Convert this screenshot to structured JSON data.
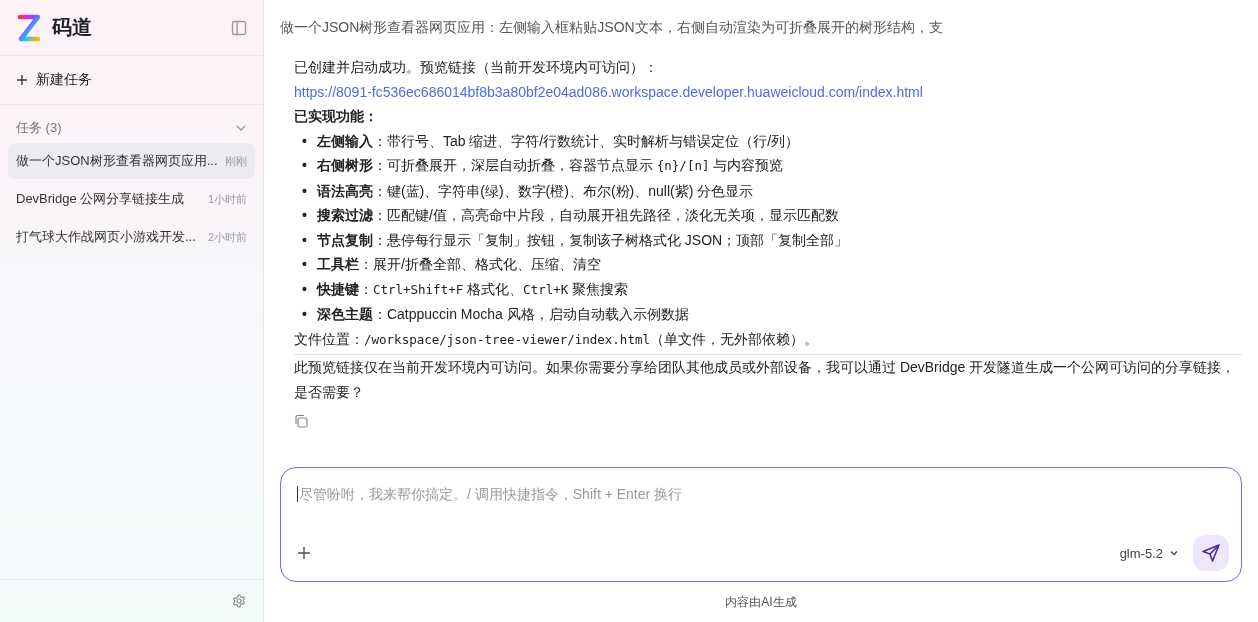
{
  "app": {
    "name": "码道"
  },
  "sidebar": {
    "new_task": "新建任务",
    "section": {
      "label": "任务 (3)",
      "expanded": true
    },
    "tasks": [
      {
        "title": "做一个JSON树形查看器网页应用...",
        "time": "刚刚",
        "selected": true
      },
      {
        "title": "DevBridge 公网分享链接生成",
        "time": "1小时前",
        "selected": false
      },
      {
        "title": "打气球大作战网页小游戏开发...",
        "time": "2小时前",
        "selected": false
      }
    ]
  },
  "conversation": {
    "title": "做一个JSON树形查看器网页应用：左侧输入框粘贴JSON文本，右侧自动渲染为可折叠展开的树形结构，支",
    "message": {
      "intro": "已创建并启动成功。预览链接（当前开发环境内可访问）：",
      "link": "https://8091-fc536ec686014bf8b3a80bf2e04ad086.workspace.developer.huaweicloud.com/index.html",
      "features_heading": "已实现功能：",
      "features": [
        {
          "marker": "•",
          "label": "左侧输入",
          "parts": [
            {
              "kind": "text",
              "text": "：带行号、Tab 缩进、字符/行数统计、实时解析与错误定位（行/列）"
            }
          ]
        },
        {
          "marker": "•",
          "label": "右侧树形",
          "parts": [
            {
              "kind": "text",
              "text": "：可折叠展开，深层自动折叠，容器节点显示 "
            },
            {
              "kind": "code",
              "text": "{n}/[n]"
            },
            {
              "kind": "text",
              "text": " 与内容预览"
            }
          ]
        },
        {
          "marker": "•",
          "label": "语法高亮",
          "parts": [
            {
              "kind": "text",
              "text": "：键(蓝)、字符串(绿)、数字(橙)、布尔(粉)、null(紫) 分色显示"
            }
          ]
        },
        {
          "marker": "•",
          "label": "搜索过滤",
          "parts": [
            {
              "kind": "text",
              "text": "：匹配键/值，高亮命中片段，自动展开祖先路径，淡化无关项，显示匹配数"
            }
          ]
        },
        {
          "marker": "•",
          "label": "节点复制",
          "parts": [
            {
              "kind": "text",
              "text": "：悬停每行显示「复制」按钮，复制该子树格式化 JSON；顶部「复制全部」"
            }
          ]
        },
        {
          "marker": "•",
          "label": "工具栏",
          "parts": [
            {
              "kind": "text",
              "text": "：展开/折叠全部、格式化、压缩、清空"
            }
          ]
        },
        {
          "marker": "•",
          "label": "快捷键",
          "parts": [
            {
              "kind": "text",
              "text": "："
            },
            {
              "kind": "code",
              "text": "Ctrl+Shift+F"
            },
            {
              "kind": "text",
              "text": " 格式化、"
            },
            {
              "kind": "code",
              "text": "Ctrl+K"
            },
            {
              "kind": "text",
              "text": " 聚焦搜索"
            }
          ]
        },
        {
          "marker": "•",
          "label": "深色主题",
          "parts": [
            {
              "kind": "text",
              "text": "：Catppuccin Mocha 风格，启动自动载入示例数据"
            }
          ]
        }
      ],
      "file_location": [
        {
          "kind": "text",
          "text": "文件位置："
        },
        {
          "kind": "code",
          "text": "/workspace/json-tree-viewer/index.html"
        },
        {
          "kind": "text",
          "text": "（单文件，无外部依赖）。"
        }
      ],
      "note": "此预览链接仅在当前开发环境内可访问。如果你需要分享给团队其他成员或外部设备，我可以通过 DevBridge 开发隧道生成一个公网可访问的分享链接，是否需要？"
    }
  },
  "composer": {
    "placeholder": "尽管吩咐，我来帮你搞定。/ 调用快捷指令，Shift + Enter 换行",
    "model": "glm-5.2"
  },
  "footer": "内容由AI生成"
}
